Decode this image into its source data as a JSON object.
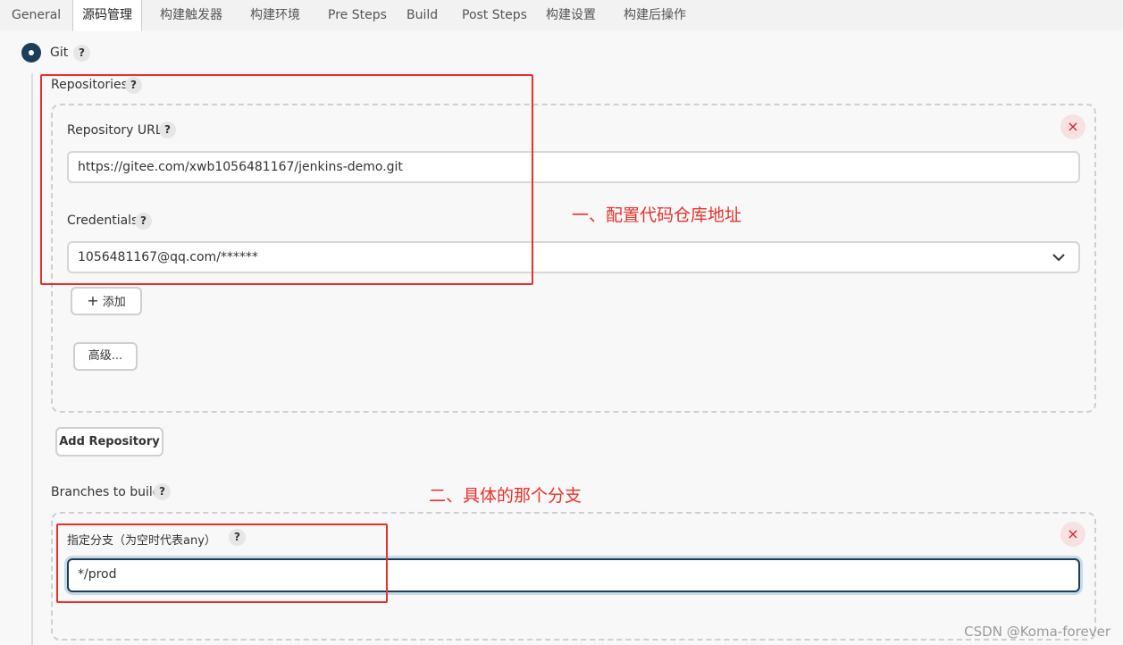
{
  "tabs": [
    {
      "label": "General"
    },
    {
      "label": "源码管理",
      "active": true
    },
    {
      "label": "构建触发器"
    },
    {
      "label": "构建环境"
    },
    {
      "label": "Pre Steps"
    },
    {
      "label": "Build"
    },
    {
      "label": "Post Steps"
    },
    {
      "label": "构建设置"
    },
    {
      "label": "构建后操作"
    }
  ],
  "scm": {
    "option_label": "Git",
    "help": "?",
    "repositories": {
      "label": "Repositories",
      "repo_url_label": "Repository URL",
      "repo_url_value": "https://gitee.com/xwb1056481167/jenkins-demo.git",
      "credentials_label": "Credentials",
      "credentials_value": "1056481167@qq.com/******",
      "add_label": "添加",
      "advanced_label": "高级...",
      "remove_symbol": "×"
    },
    "add_repository_label": "Add Repository",
    "branches": {
      "label": "Branches to build",
      "branch_specifier_label": "指定分支（为空时代表any）",
      "branch_value": "*/prod",
      "remove_symbol": "×"
    }
  },
  "annotations": {
    "note1": "一、配置代码仓库地址",
    "note2": "二、具体的那个分支"
  },
  "watermark": "CSDN @Koma-forever",
  "colors": {
    "accent": "#1d3e5b",
    "annotation": "#e8312a",
    "remove": "#d0242b"
  }
}
